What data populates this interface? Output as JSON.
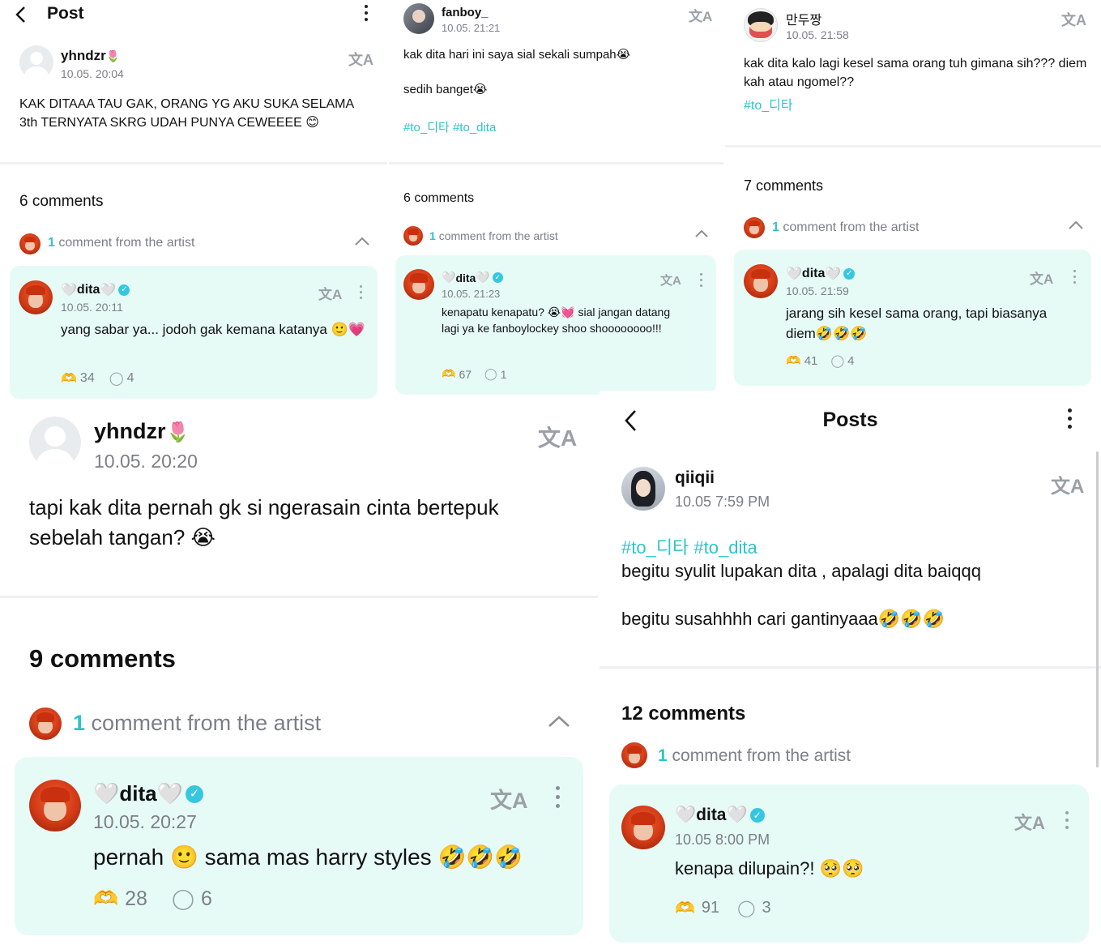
{
  "panel_a": {
    "header_title": "Post",
    "post": {
      "username": "yhndzr",
      "username_emoji": "🌷",
      "timestamp": "10.05. 20:04",
      "text": "KAK DITAAA TAU GAK, ORANG YG AKU SUKA SELAMA 3th TERNYATA SKRG UDAH PUNYA CEWEEEE 😊"
    },
    "comments_label": "6 comments",
    "artist_count": "1",
    "artist_label": "comment from the artist",
    "reply": {
      "name": "dita",
      "timestamp": "10.05. 20:11",
      "text": "yang sabar ya... jodoh gak kemana katanya 🙂💗",
      "likes": "34",
      "replies": "4"
    }
  },
  "panel_b": {
    "post": {
      "username": "fanboy_",
      "timestamp": "10.05. 21:21",
      "line1": "kak dita hari ini saya sial sekali sumpah😭",
      "line2": "sedih banget😭",
      "hashtags": "#to_디타 #to_dita"
    },
    "comments_label": "6 comments",
    "artist_count": "1",
    "artist_label": "comment from the artist",
    "reply": {
      "name": "dita",
      "timestamp": "10.05. 21:23",
      "text": "kenapatu kenapatu? 😭💓 sial jangan datang lagi ya ke fanboylockey shoo shoooooooo!!!",
      "likes": "67",
      "replies": "1"
    }
  },
  "panel_c": {
    "post": {
      "username": "만두짱",
      "timestamp": "10.05. 21:58",
      "text": "kak dita kalo lagi kesel sama orang tuh gimana sih??? diem kah atau ngomel??",
      "hashtags": "#to_디타"
    },
    "comments_label": "7 comments",
    "artist_count": "1",
    "artist_label": "comment from the artist",
    "reply": {
      "name": "dita",
      "timestamp": "10.05. 21:59",
      "text": "jarang sih kesel sama orang, tapi biasanya diem🤣🤣🤣",
      "likes": "41",
      "replies": "4"
    }
  },
  "panel_d": {
    "post": {
      "username": "yhndzr",
      "username_emoji": "🌷",
      "timestamp": "10.05. 20:20",
      "text": "tapi kak dita pernah gk si ngerasain cinta bertepuk sebelah tangan? 😭"
    },
    "comments_label": "9 comments",
    "artist_count": "1",
    "artist_label": "comment from the artist",
    "reply": {
      "name": "dita",
      "timestamp": "10.05. 20:27",
      "text": "pernah 🙂 sama mas harry styles 🤣🤣🤣",
      "likes": "28",
      "replies": "6"
    }
  },
  "panel_e": {
    "header_title": "Posts",
    "post": {
      "username": "qiiqii",
      "timestamp": "10.05 7:59 PM",
      "hashtags": "#to_디타  #to_dita",
      "line1": "begitu syulit lupakan dita , apalagi dita baiqqq",
      "line2": "begitu susahhhh cari gantinyaaa🤣🤣🤣"
    },
    "comments_label": "12 comments",
    "artist_count": "1",
    "artist_label": "comment from the artist",
    "reply": {
      "name": "dita",
      "timestamp": "10.05 8:00 PM",
      "text": "kenapa dilupain?! 🥺🥺",
      "likes": "91",
      "replies": "3"
    }
  },
  "icons": {
    "translate": "文A",
    "heart": "🤍",
    "verified": "✓",
    "like": "🫶",
    "comment": "◯"
  },
  "colors": {
    "accent": "#2ec4c9",
    "card_bg": "#e6fbf6",
    "verified": "#36c7e0",
    "meta_grey": "#7b7f86"
  }
}
